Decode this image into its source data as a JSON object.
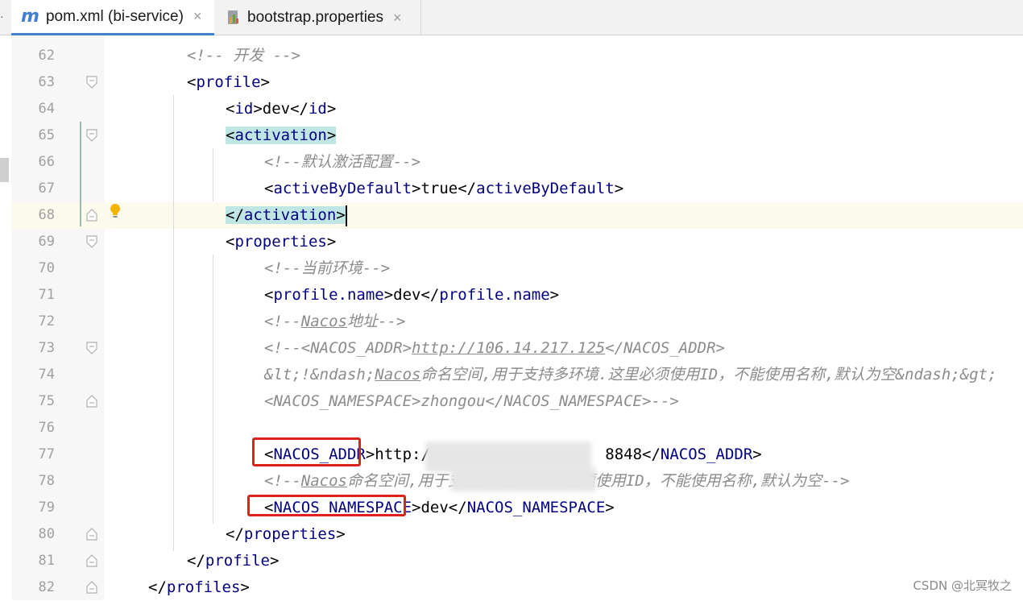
{
  "tabs": [
    {
      "label": "pom.xml (bi-service)",
      "icon": "maven-icon",
      "active": true
    },
    {
      "label": "bootstrap.properties",
      "icon": "properties-file-icon",
      "active": false
    }
  ],
  "tab_close_glyph": "×",
  "editor": {
    "current_line": 68,
    "lines": [
      {
        "n": "62",
        "segs": [
          {
            "t": "<!-- 开发 -->",
            "k": "c"
          }
        ]
      },
      {
        "n": "63",
        "segs": [
          {
            "t": "<",
            "k": "p"
          },
          {
            "t": "profile",
            "k": "t"
          },
          {
            "t": ">",
            "k": "p"
          }
        ]
      },
      {
        "n": "64",
        "segs": [
          {
            "t": "<",
            "k": "p"
          },
          {
            "t": "id",
            "k": "t"
          },
          {
            "t": ">dev</",
            "k": "p"
          },
          {
            "t": "id",
            "k": "t"
          },
          {
            "t": ">",
            "k": "p"
          }
        ]
      },
      {
        "n": "65",
        "segs": [
          {
            "t": "<",
            "k": "p"
          },
          {
            "t": "activation",
            "k": "t"
          },
          {
            "t": ">",
            "k": "p"
          }
        ]
      },
      {
        "n": "66",
        "segs": [
          {
            "t": "<!--默认激活配置-->",
            "k": "c"
          }
        ]
      },
      {
        "n": "67",
        "segs": [
          {
            "t": "<",
            "k": "p"
          },
          {
            "t": "activeByDefault",
            "k": "t"
          },
          {
            "t": ">true</",
            "k": "p"
          },
          {
            "t": "activeByDefault",
            "k": "t"
          },
          {
            "t": ">",
            "k": "p"
          }
        ]
      },
      {
        "n": "68",
        "segs": [
          {
            "t": "</",
            "k": "p"
          },
          {
            "t": "activation",
            "k": "t"
          },
          {
            "t": ">",
            "k": "p"
          }
        ]
      },
      {
        "n": "69",
        "segs": [
          {
            "t": "<",
            "k": "p"
          },
          {
            "t": "properties",
            "k": "t"
          },
          {
            "t": ">",
            "k": "p"
          }
        ]
      },
      {
        "n": "70",
        "segs": [
          {
            "t": "<!--当前环境-->",
            "k": "c"
          }
        ]
      },
      {
        "n": "71",
        "segs": [
          {
            "t": "<",
            "k": "p"
          },
          {
            "t": "profile.name",
            "k": "t"
          },
          {
            "t": ">dev</",
            "k": "p"
          },
          {
            "t": "profile.name",
            "k": "t"
          },
          {
            "t": ">",
            "k": "p"
          }
        ]
      },
      {
        "n": "72",
        "segs": [
          {
            "t": "<!--",
            "k": "c"
          },
          {
            "t": "Nacos",
            "k": "cu"
          },
          {
            "t": "地址-->",
            "k": "c"
          }
        ]
      },
      {
        "n": "73",
        "segs": [
          {
            "t": "<!--<NACOS_ADDR>",
            "k": "c"
          },
          {
            "t": "http://106.14.217.125",
            "k": "cu"
          },
          {
            "t": "</NACOS_ADDR>",
            "k": "c"
          }
        ]
      },
      {
        "n": "74",
        "segs": [
          {
            "t": "&lt;!&ndash;",
            "k": "c"
          },
          {
            "t": "Nacos",
            "k": "cu"
          },
          {
            "t": "命名空间,用于支持多环境.这里必须使用ID，不能使用名称,默认为空&ndash;&gt;",
            "k": "c"
          }
        ]
      },
      {
        "n": "75",
        "segs": [
          {
            "t": "<NACOS_NAMESPACE>zhongou</NACOS_NAMESPACE>-->",
            "k": "c"
          }
        ]
      },
      {
        "n": "76",
        "segs": []
      },
      {
        "n": "77",
        "segs": [
          {
            "t": "<",
            "k": "p"
          },
          {
            "t": "NACOS_ADDR",
            "k": "tu"
          },
          {
            "t": ">http:/",
            "k": "p"
          },
          {
            "t": "                   ",
            "k": "p"
          },
          {
            "t": "8848</",
            "k": "p"
          },
          {
            "t": "NACOS_ADDR",
            "k": "t"
          },
          {
            "t": ">",
            "k": "p"
          }
        ]
      },
      {
        "n": "78",
        "segs": [
          {
            "t": "<!--",
            "k": "c"
          },
          {
            "t": "Nacos",
            "k": "cu"
          },
          {
            "t": "命名空间,用于支持多环境.这里必须使用ID，不能使用名称,默认为空-->",
            "k": "c"
          }
        ]
      },
      {
        "n": "79",
        "segs": [
          {
            "t": "<",
            "k": "p"
          },
          {
            "t": "NACOS_NAMESPACE",
            "k": "tu"
          },
          {
            "t": ">dev</",
            "k": "p"
          },
          {
            "t": "NACOS_NAMESPACE",
            "k": "t"
          },
          {
            "t": ">",
            "k": "p"
          }
        ]
      },
      {
        "n": "80",
        "segs": [
          {
            "t": "</",
            "k": "p"
          },
          {
            "t": "properties",
            "k": "t"
          },
          {
            "t": ">",
            "k": "p"
          }
        ]
      },
      {
        "n": "81",
        "segs": [
          {
            "t": "</",
            "k": "p"
          },
          {
            "t": "profile",
            "k": "t"
          },
          {
            "t": ">",
            "k": "p"
          }
        ]
      },
      {
        "n": "82",
        "segs": [
          {
            "t": "</",
            "k": "p"
          },
          {
            "t": "profiles",
            "k": "t"
          },
          {
            "t": ">",
            "k": "p"
          }
        ]
      }
    ]
  },
  "watermark": "CSDN @北冥牧之",
  "colors": {
    "tag": "#000080",
    "comment": "#8c8c8c",
    "highlight": "#bfe6e4",
    "annotation_box": "#e0201b",
    "current_line": "#fcfaed"
  }
}
